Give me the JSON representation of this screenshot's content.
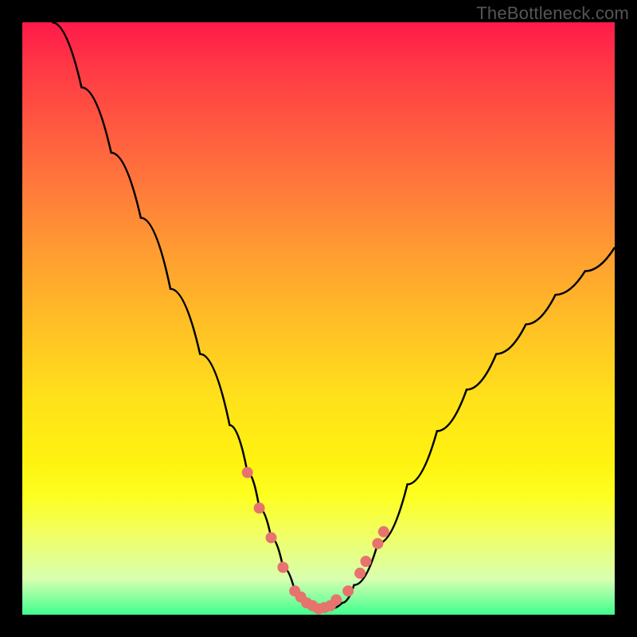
{
  "watermark": "TheBottleneck.com",
  "chart_data": {
    "type": "line",
    "title": "",
    "xlabel": "",
    "ylabel": "",
    "xlim": [
      0,
      100
    ],
    "ylim": [
      0,
      100
    ],
    "series": [
      {
        "name": "bottleneck-curve",
        "x": [
          5,
          10,
          15,
          20,
          25,
          30,
          35,
          38,
          40,
          42,
          44,
          46,
          48,
          50,
          52,
          54,
          56,
          60,
          65,
          70,
          75,
          80,
          85,
          90,
          95,
          100
        ],
        "values": [
          100,
          89,
          78,
          67,
          55,
          44,
          32,
          24,
          18,
          13,
          8,
          4,
          2,
          1,
          1,
          2,
          5,
          12,
          22,
          31,
          38,
          44,
          49,
          54,
          58,
          62
        ]
      }
    ],
    "markers": {
      "name": "highlight-points",
      "x": [
        38,
        40,
        42,
        44,
        46,
        47,
        48,
        49,
        50,
        51,
        52,
        53,
        55,
        57,
        58,
        60,
        61
      ],
      "values": [
        24,
        18,
        13,
        8,
        4,
        3,
        2,
        1.5,
        1,
        1.2,
        1.5,
        2.5,
        4,
        7,
        9,
        12,
        14
      ]
    }
  }
}
